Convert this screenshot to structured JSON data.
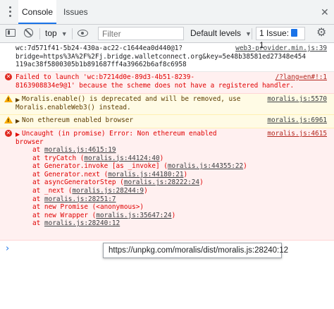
{
  "tabs": [
    "Console",
    "Issues"
  ],
  "toolbar": {
    "context": "top",
    "filter_placeholder": "Filter",
    "levels": "Default levels",
    "issue_label": "1 Issue:",
    "issue_count": "1"
  },
  "messages": [
    {
      "type": "log",
      "lines": [
        "wc:7d571f41-5b24-430a-ac22-c1644ea0d440@1?",
        "bridge=https%3A%2F%2Fj.bridge.walletconnect.org&key=5e48b38581ed27348e454",
        "119ac38f5800305b1b891687ff4a39662b6af8c6958"
      ],
      "source": "web3-provider.min.js:39"
    },
    {
      "type": "error",
      "lines": [
        "Failed to launch 'wc:b7214d0e-89d3-4b51-8239-",
        "8163908834e9@1' because the scheme does not have a registered handler."
      ],
      "source": "/?lang=en#!:1"
    },
    {
      "type": "warning",
      "lines": [
        "Moralis.enable() is deprecated and will be removed, use",
        "Moralis.enableWeb3() instead."
      ],
      "source": "moralis.js:5570"
    },
    {
      "type": "warning",
      "lines": [
        "Non ethereum enabled browser"
      ],
      "source": "moralis.js:6961"
    },
    {
      "type": "error",
      "lines": [
        "Uncaught (in promise) Error: Non ethereum enabled",
        "browser"
      ],
      "source": "moralis.js:4615",
      "stack": [
        {
          "prefix": "at ",
          "link": "moralis.js:4615:19",
          "suffix": ""
        },
        {
          "prefix": "at tryCatch (",
          "link": "moralis.js:44124:40",
          "suffix": ")"
        },
        {
          "prefix": "at Generator.invoke [as _invoke] (",
          "link": "moralis.js:44355:22",
          "suffix": ")"
        },
        {
          "prefix": "at Generator.next (",
          "link": "moralis.js:44180:21",
          "suffix": ")"
        },
        {
          "prefix": "at asyncGeneratorStep (",
          "link": "moralis.js:28222:24",
          "suffix": ")"
        },
        {
          "prefix": "at _next (",
          "link": "moralis.js:28244:9",
          "suffix": ")"
        },
        {
          "prefix": "at ",
          "link": "moralis.js:28251:7",
          "suffix": ""
        },
        {
          "prefix": "at new Promise (<anonymous>)",
          "link": "",
          "suffix": ""
        },
        {
          "prefix": "at new Wrapper (",
          "link": "moralis.js:35647:24",
          "suffix": ")"
        },
        {
          "prefix": "at ",
          "link": "moralis.js:28240:12",
          "suffix": ""
        }
      ]
    }
  ],
  "prompt_symbol": "›",
  "tooltip": "https://unpkg.com/moralis/dist/moralis.js:28240:12",
  "colors": {
    "error_bg": "#fff0f0",
    "error_text": "#e00000",
    "warning_bg": "#fffbe5",
    "accent": "#1a73e8"
  }
}
